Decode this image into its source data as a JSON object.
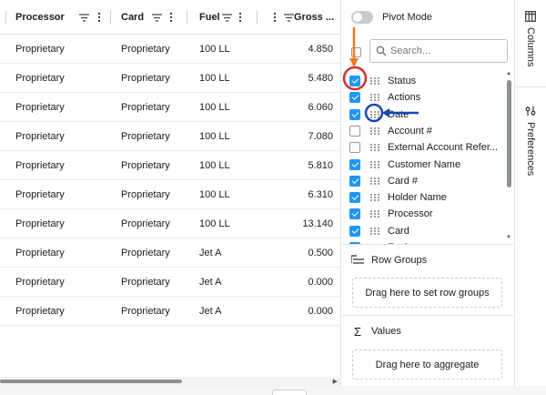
{
  "grid": {
    "columns": [
      {
        "label": "Processor",
        "menu": true,
        "filter": true
      },
      {
        "label": "Card",
        "menu": true,
        "filter": true
      },
      {
        "label": "Fuel",
        "menu": true,
        "filter": true
      },
      {
        "label": "Gross ...",
        "menu": true,
        "filter": true
      }
    ],
    "rows": [
      [
        "Proprietary",
        "Proprietary",
        "100 LL",
        "4.850"
      ],
      [
        "Proprietary",
        "Proprietary",
        "100 LL",
        "5.480"
      ],
      [
        "Proprietary",
        "Proprietary",
        "100 LL",
        "6.060"
      ],
      [
        "Proprietary",
        "Proprietary",
        "100 LL",
        "7.080"
      ],
      [
        "Proprietary",
        "Proprietary",
        "100 LL",
        "5.810"
      ],
      [
        "Proprietary",
        "Proprietary",
        "100 LL",
        "6.310"
      ],
      [
        "Proprietary",
        "Proprietary",
        "100 LL",
        "13.140"
      ],
      [
        "Proprietary",
        "Proprietary",
        "Jet A",
        "0.500"
      ],
      [
        "Proprietary",
        "Proprietary",
        "Jet A",
        "0.000"
      ],
      [
        "Proprietary",
        "Proprietary",
        "Jet A",
        "0.000"
      ]
    ]
  },
  "panel": {
    "pivot_label": "Pivot Mode",
    "search_placeholder": "Search...",
    "columns": [
      {
        "label": "Status",
        "checked": true
      },
      {
        "label": "Actions",
        "checked": true
      },
      {
        "label": "Date",
        "checked": true
      },
      {
        "label": "Account #",
        "checked": false
      },
      {
        "label": "External Account Refer...",
        "checked": false
      },
      {
        "label": "Customer Name",
        "checked": true
      },
      {
        "label": "Card #",
        "checked": true
      },
      {
        "label": "Holder Name",
        "checked": true
      },
      {
        "label": "Processor",
        "checked": true
      },
      {
        "label": "Card",
        "checked": true
      },
      {
        "label": "Fuel",
        "checked": true
      }
    ],
    "row_groups_title": "Row Groups",
    "row_groups_drop": "Drag here to set row groups",
    "values_title": "Values",
    "values_drop": "Drag here to aggregate"
  },
  "side_tabs": [
    {
      "label": "Columns",
      "icon": "columns-icon"
    },
    {
      "label": "Preferences",
      "icon": "preferences-icon"
    }
  ],
  "colors": {
    "accent": "#2196f3",
    "annotation_orange": "#f07a1e",
    "annotation_red": "#d32f2f",
    "annotation_blue": "#1546b8"
  }
}
